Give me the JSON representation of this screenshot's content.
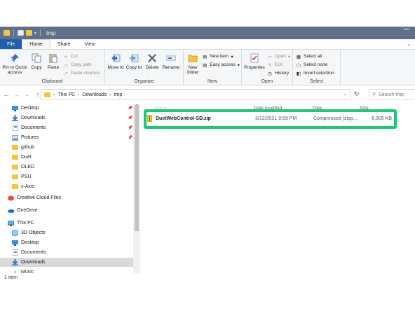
{
  "window": {
    "title": "tmp"
  },
  "ribbon_tabs": [
    "File",
    "Home",
    "Share",
    "View"
  ],
  "ribbon": {
    "clipboard": {
      "label": "Clipboard",
      "pin_to_quick_access": "Pin to Quick access",
      "copy": "Copy",
      "paste": "Paste",
      "cut": "Cut",
      "copy_path": "Copy path",
      "paste_shortcut": "Paste shortcut"
    },
    "organize": {
      "label": "Organize",
      "move_to": "Move to",
      "copy_to": "Copy to",
      "delete": "Delete",
      "rename": "Rename"
    },
    "new": {
      "label": "New",
      "new_folder": "New folder",
      "new_item": "New item",
      "easy_access": "Easy access"
    },
    "open": {
      "label": "Open",
      "properties": "Properties",
      "open": "Open",
      "edit": "Edit",
      "history": "History"
    },
    "select": {
      "label": "Select",
      "select_all": "Select all",
      "select_none": "Select none",
      "invert_selection": "Invert selection"
    }
  },
  "address": {
    "breadcrumbs": [
      "This PC",
      "Downloads",
      "tmp"
    ],
    "search_placeholder": "Search tmp"
  },
  "nav_pane": {
    "items": [
      {
        "label": "Desktop",
        "icon": "desktop-icon",
        "pinned": true
      },
      {
        "label": "Downloads",
        "icon": "download-icon",
        "pinned": true
      },
      {
        "label": "Documents",
        "icon": "documents-icon",
        "pinned": true
      },
      {
        "label": "Pictures",
        "icon": "pictures-icon",
        "pinned": true
      },
      {
        "label": "github",
        "icon": "folder-icon",
        "pinned": false
      },
      {
        "label": "Duet",
        "icon": "folder-icon",
        "pinned": false
      },
      {
        "label": "OLED",
        "icon": "folder-icon",
        "pinned": false
      },
      {
        "label": "PSU",
        "icon": "folder-icon",
        "pinned": false
      },
      {
        "label": "x-Axis",
        "icon": "folder-icon",
        "pinned": false
      },
      {
        "label": "Creative Cloud Files",
        "icon": "creative-cloud-icon",
        "pinned": false
      },
      {
        "label": "OneDrive",
        "icon": "onedrive-icon",
        "pinned": false
      },
      {
        "label": "This PC",
        "icon": "this-pc-icon",
        "pinned": false
      },
      {
        "label": "3D Objects",
        "icon": "3d-objects-icon",
        "pinned": false
      },
      {
        "label": "Desktop",
        "icon": "desktop-icon",
        "pinned": false
      },
      {
        "label": "Documents",
        "icon": "documents-icon",
        "pinned": false
      },
      {
        "label": "Downloads",
        "icon": "download-icon",
        "pinned": false,
        "selected": true
      },
      {
        "label": "Music",
        "icon": "music-icon",
        "pinned": false
      }
    ]
  },
  "file_list": {
    "columns": [
      "Name",
      "Date modified",
      "Type",
      "Size"
    ],
    "rows": [
      {
        "name": "DuetWebControl-SD.zip",
        "date": "3/12/2021 9:59 PM",
        "type": "Compressed (zipp...",
        "size": "6,905 KB"
      }
    ]
  },
  "status_bar": {
    "item_count": "1 item"
  },
  "colors": {
    "title_bar": "#5f7088",
    "file_tab": "#1f5fad",
    "highlight_box": "#22c476"
  }
}
